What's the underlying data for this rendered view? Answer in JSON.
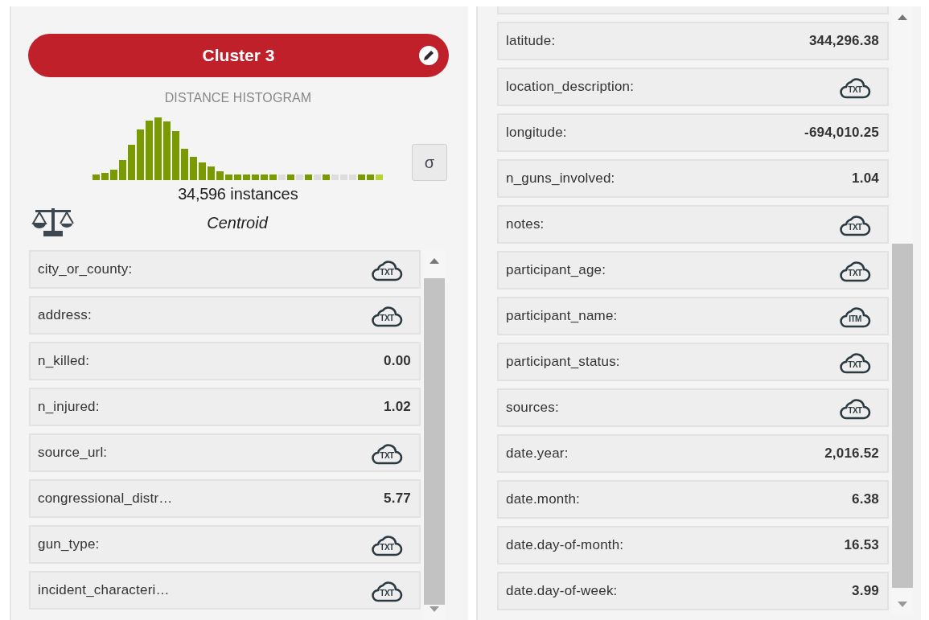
{
  "cluster": {
    "title": "Cluster 3",
    "histogram_title": "DISTANCE HISTOGRAM",
    "sigma_button": "σ",
    "instances_count": "34,596",
    "instances_label": "instances",
    "centroid_label": "Centroid"
  },
  "left_fields": [
    {
      "name": "city_or_county:",
      "kind": "text",
      "badge": "TXT"
    },
    {
      "name": "address:",
      "kind": "text",
      "badge": "TXT"
    },
    {
      "name": "n_killed:",
      "kind": "numeric",
      "value": "0.00"
    },
    {
      "name": "n_injured:",
      "kind": "numeric",
      "value": "1.02"
    },
    {
      "name": "source_url:",
      "kind": "text",
      "badge": "TXT"
    },
    {
      "name": "congressional_distr…",
      "kind": "numeric",
      "value": "5.77"
    },
    {
      "name": "gun_type:",
      "kind": "text",
      "badge": "TXT"
    },
    {
      "name": "incident_characteri…",
      "kind": "text",
      "badge": "TXT"
    }
  ],
  "right_fields": [
    {
      "name": "latitude:",
      "kind": "numeric",
      "value": "344,296.38"
    },
    {
      "name": "location_description:",
      "kind": "text",
      "badge": "TXT"
    },
    {
      "name": "longitude:",
      "kind": "numeric",
      "value": "-694,010.25"
    },
    {
      "name": "n_guns_involved:",
      "kind": "numeric",
      "value": "1.04"
    },
    {
      "name": "notes:",
      "kind": "text",
      "badge": "TXT"
    },
    {
      "name": "participant_age:",
      "kind": "text",
      "badge": "TXT"
    },
    {
      "name": "participant_name:",
      "kind": "items",
      "badge": "ITM"
    },
    {
      "name": "participant_status:",
      "kind": "text",
      "badge": "TXT"
    },
    {
      "name": "sources:",
      "kind": "text",
      "badge": "TXT"
    },
    {
      "name": "date.year:",
      "kind": "numeric",
      "value": "2,016.52"
    },
    {
      "name": "date.month:",
      "kind": "numeric",
      "value": "6.38"
    },
    {
      "name": "date.day-of-month:",
      "kind": "numeric",
      "value": "16.53"
    },
    {
      "name": "date.day-of-week:",
      "kind": "numeric",
      "value": "3.99"
    }
  ]
}
